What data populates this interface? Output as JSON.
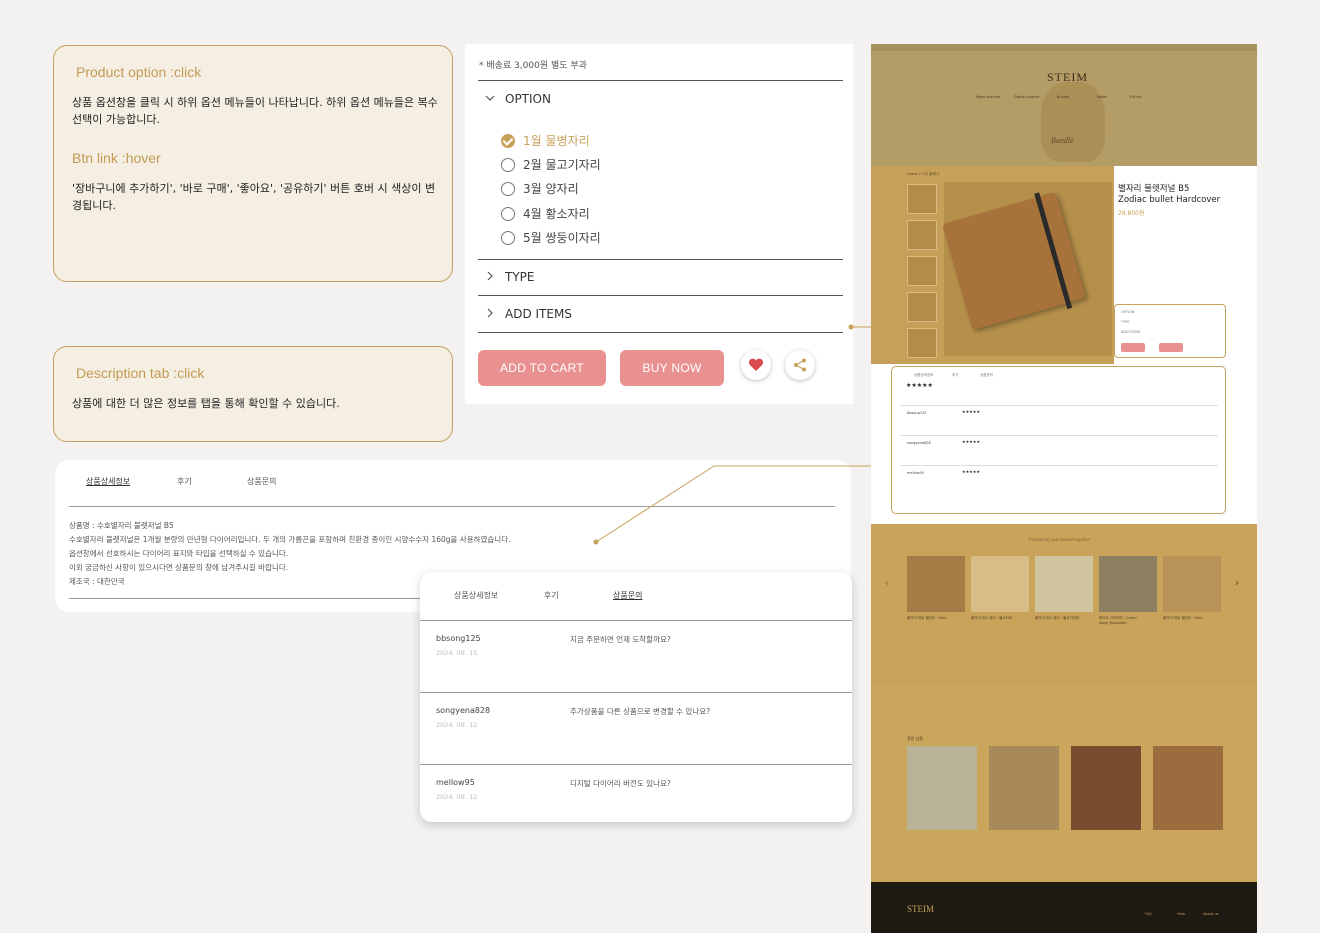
{
  "notes": {
    "product_option_title": "Product option :click",
    "product_option_desc": "상품 옵션창을 클릭 시 하위 옵션 메뉴들이 나타납니다. 하위 옵션 메뉴들은 복수 선택이 가능합니다.",
    "btn_link_title": "Btn link :hover",
    "btn_link_desc": "'장바구니에 추가하기', '바로 구매', '좋아요', '공유하기' 버튼 호버 시 색상이 변경됩니다.",
    "description_title": "Description tab :click",
    "description_desc": "상품에 대한 더 많은 정보를 탭을 통해 확인할 수 있습니다."
  },
  "option_panel": {
    "shipping_note": "* 배송료 3,000원 별도 부과",
    "option_label": "OPTION",
    "options": [
      {
        "label": "1월 물병자리",
        "selected": true
      },
      {
        "label": "2월 물고기자리",
        "selected": false
      },
      {
        "label": "3월 양자리",
        "selected": false
      },
      {
        "label": "4월 황소자리",
        "selected": false
      },
      {
        "label": "5월 쌍둥이자리",
        "selected": false
      }
    ],
    "type_label": "TYPE",
    "add_items_label": "ADD ITEMS",
    "add_to_cart": "ADD TO CART",
    "buy_now": "BUY NOW",
    "like_icon": "heart-icon",
    "share_icon": "share-icon",
    "accent_color": "#e99191",
    "selected_color": "#c8a15a"
  },
  "detail_tabs": {
    "tabs": [
      "상품상세정보",
      "후기",
      "상품문의"
    ],
    "lines": [
      "상품명 : 수호별자리 불렛저널 B5",
      "수호별자리 불렛저널은 1개월 분량의 만년형 다이어리입니다. 두 개의 가름끈을 포함하며 친환경 종이인 시양수수지 160g을 사용하였습니다.",
      "옵션창에서 선호하시는 다이어리 표지와 타입을 선택하실 수 있습니다.",
      "이외 궁금하신 사항이 있으시다면 상품문의 창에 남겨주시길 바랍니다.",
      "제조국 : 대한민국"
    ]
  },
  "qa_tabs": {
    "tabs": [
      "상품상세정보",
      "후기",
      "상품문의"
    ],
    "items": [
      {
        "user": "bbsong125",
        "date": "2024. 09. 15",
        "question": "지금 주문하면 언제 도착할까요?"
      },
      {
        "user": "songyena828",
        "date": "2024. 09. 12",
        "question": "추가상품을 다른 상품으로 변경할 수 있나요?"
      },
      {
        "user": "mellow95",
        "date": "2024. 09. 12",
        "question": "디지털 다이어리 버전도 있나요?"
      }
    ]
  },
  "preview": {
    "logo": "STEIM",
    "nav": [
      "Paper planner",
      "Digital planner",
      "Bundle",
      "Notes",
      "Gift set"
    ],
    "hero_label": "Bundle",
    "breadcrumb": "Home > 1년 플래너",
    "product_title_1": "별자리 불렛저널 B5",
    "product_title_2": "Zodiac bullet Hardcover",
    "price": "29,800원",
    "sel_lines": [
      "OPTION",
      "TYPE",
      "ADD ITEMS"
    ],
    "review_tabs": [
      "상품상세정보",
      "후기",
      "상품문의"
    ],
    "review_users": [
      "bbsong125",
      "songyena828",
      "mellow95"
    ],
    "freq_title": "Frequently purchased together",
    "freq_items": [
      "별자리 탁상 캘린더 : Gold",
      "별자리 미니 엽서 : 별쇼자리",
      "별자리 미니 엽서 : 물고기자리",
      "화이트 다이어리 : Green Sage_Moonlight",
      "별자리 탁상 캘린더 : Gold"
    ],
    "rec_title": "관련 상품",
    "footer_cols": [
      "FAQ",
      "Help",
      "About us"
    ]
  }
}
